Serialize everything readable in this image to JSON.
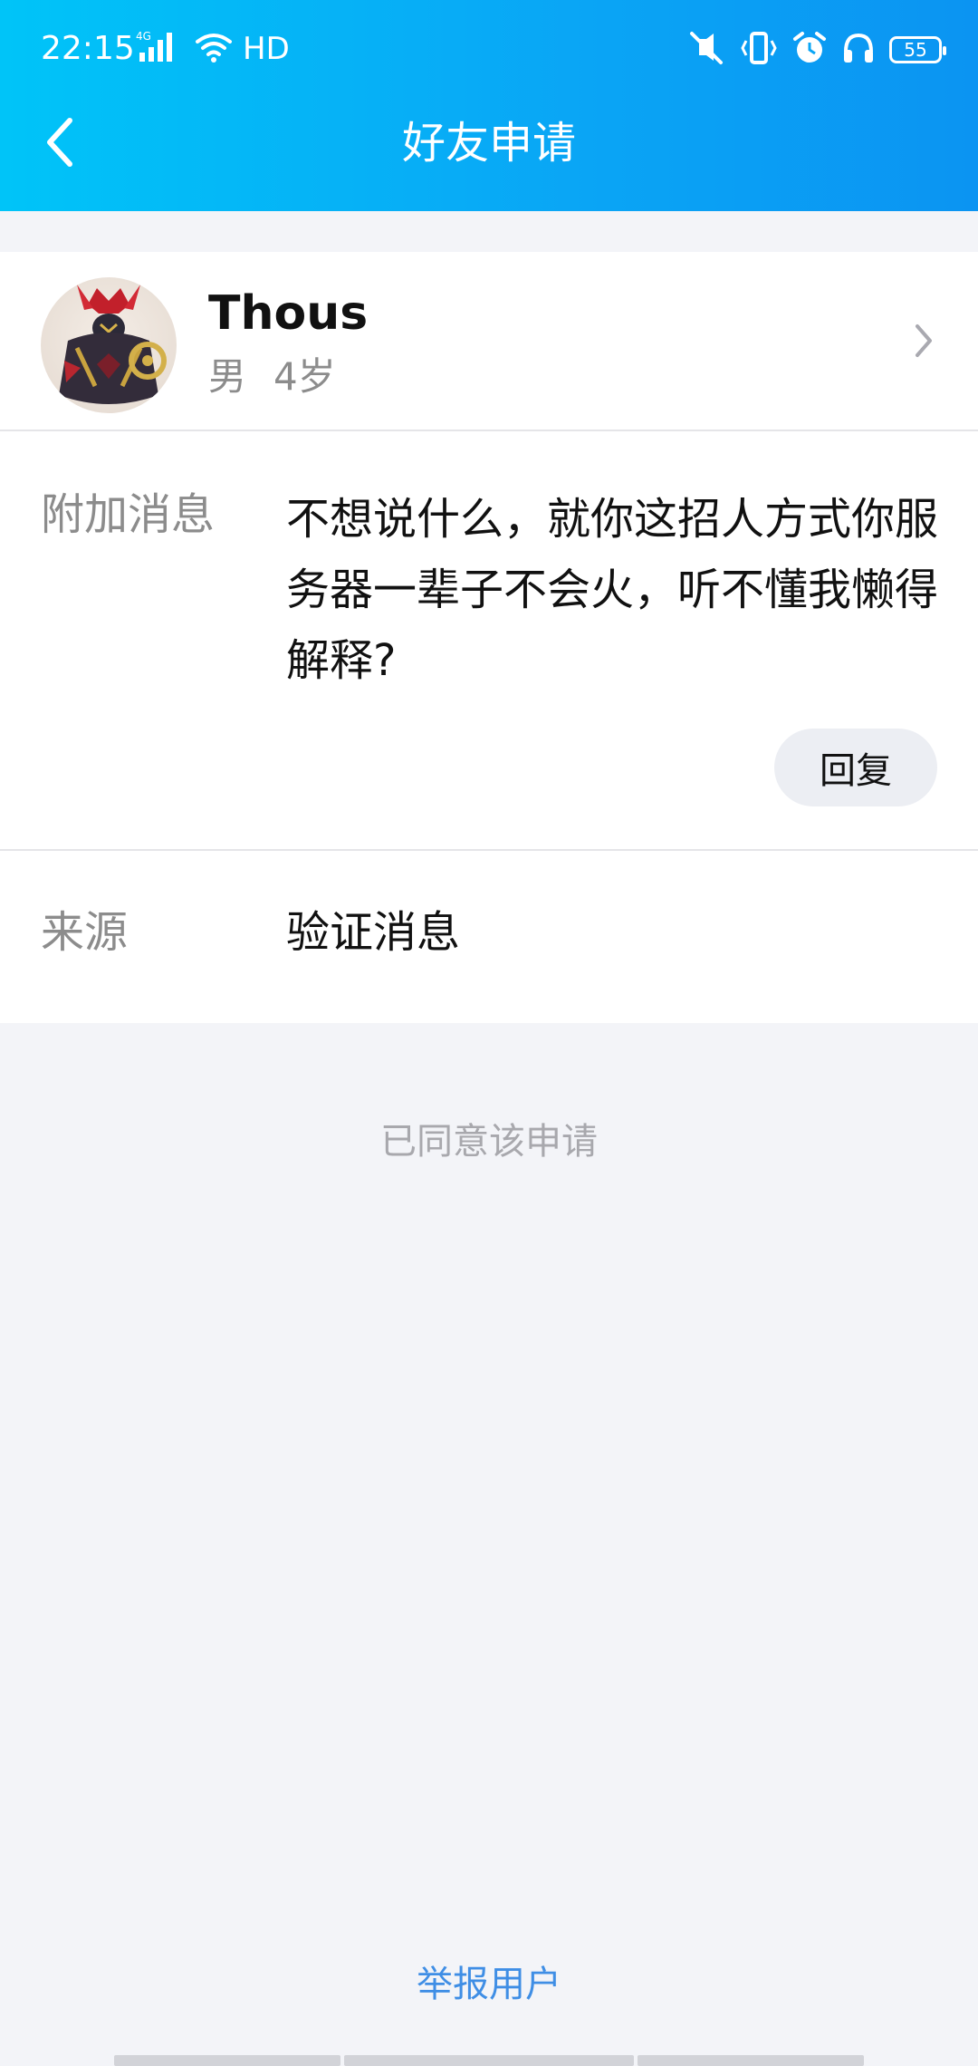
{
  "status_bar": {
    "time": "22:15",
    "network_label": "4G",
    "hd_label": "HD",
    "battery_level": "55",
    "icons": [
      "signal-icon",
      "wifi-icon",
      "mute-icon",
      "vibrate-icon",
      "alarm-icon",
      "headset-icon",
      "battery-icon"
    ]
  },
  "header": {
    "title": "好友申请",
    "back_icon": "back-arrow-icon"
  },
  "profile": {
    "name": "Thous",
    "gender": "男",
    "age": "4岁"
  },
  "message": {
    "label": "附加消息",
    "text": "不想说什么，就你这招人方式你服务器一辈子不会火，听不懂我懒得解释?",
    "reply_label": "回复"
  },
  "source": {
    "label": "来源",
    "value": "验证消息"
  },
  "status_note": "已同意该申请",
  "report_label": "举报用户",
  "colors": {
    "header_start": "#00c4f8",
    "header_end": "#0b94f2",
    "link": "#3f8ee5",
    "background": "#f3f4f8"
  }
}
